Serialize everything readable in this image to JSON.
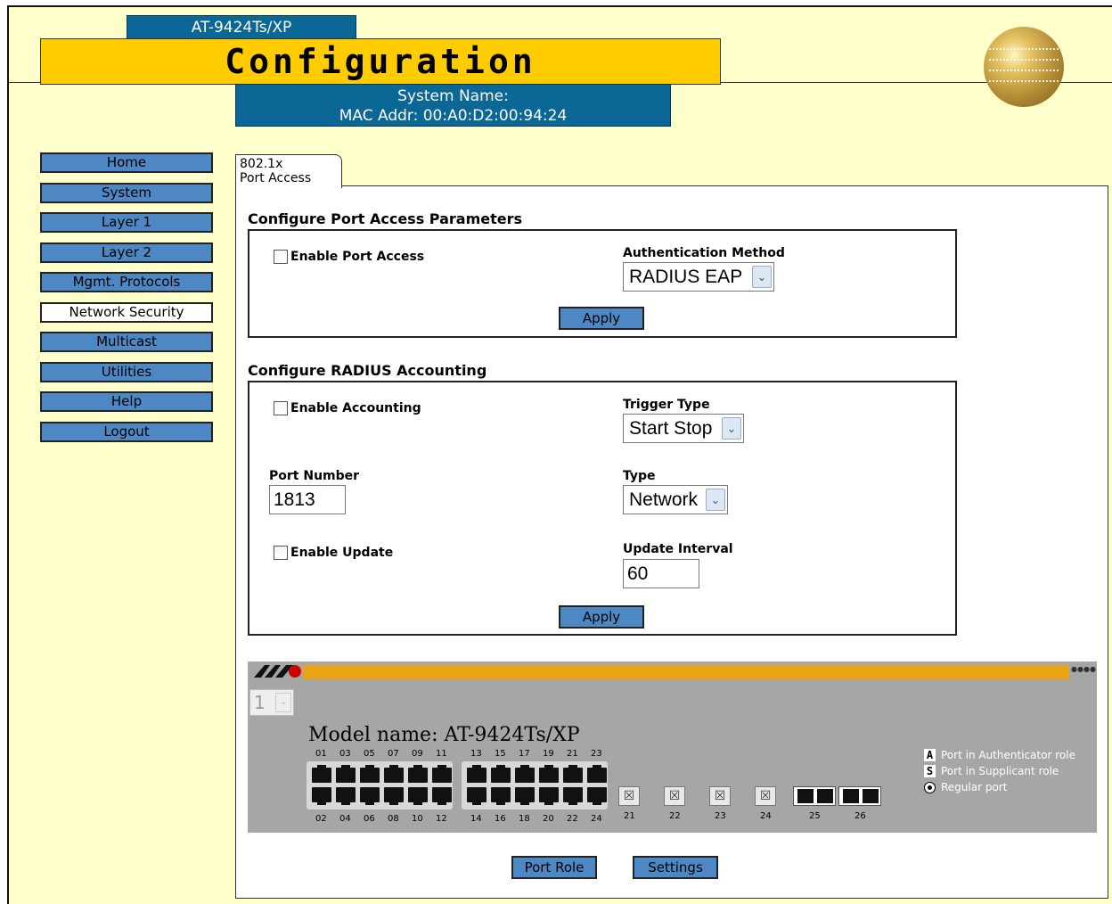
{
  "header": {
    "model_tab": "AT-9424Ts/XP",
    "banner_title": "Configuration",
    "system_name": "System Name:",
    "mac_addr": "MAC Addr: 00:A0:D2:00:94:24"
  },
  "nav": {
    "items": [
      {
        "label": "Home"
      },
      {
        "label": "System"
      },
      {
        "label": "Layer 1"
      },
      {
        "label": "Layer 2"
      },
      {
        "label": "Mgmt. Protocols"
      },
      {
        "label": "Network Security"
      },
      {
        "label": "Multicast"
      },
      {
        "label": "Utilities"
      },
      {
        "label": "Help"
      },
      {
        "label": "Logout"
      }
    ],
    "active": "Network Security"
  },
  "tab": {
    "line1": "802.1x",
    "line2": "Port Access"
  },
  "port_access": {
    "title": "Configure Port Access Parameters",
    "enable_label": "Enable Port Access",
    "enable_checked": false,
    "auth_method_label": "Authentication Method",
    "auth_method_value": "RADIUS EAP",
    "apply_label": "Apply"
  },
  "radius": {
    "title": "Configure RADIUS Accounting",
    "enable_label": "Enable Accounting",
    "enable_checked": false,
    "trigger_type_label": "Trigger Type",
    "trigger_type_value": "Start Stop",
    "port_number_label": "Port Number",
    "port_number_value": "1813",
    "type_label": "Type",
    "type_value": "Network",
    "enable_update_label": "Enable Update",
    "enable_update_checked": false,
    "update_interval_label": "Update Interval",
    "update_interval_value": "60",
    "apply_label": "Apply"
  },
  "switch": {
    "unit_value": "1",
    "model_name": "Model name: AT-9424Ts/XP",
    "top_port_numbers_a": [
      "01",
      "03",
      "05",
      "07",
      "09",
      "11"
    ],
    "top_port_numbers_b": [
      "13",
      "15",
      "17",
      "19",
      "21",
      "23"
    ],
    "bottom_port_numbers_a": [
      "02",
      "04",
      "06",
      "08",
      "10",
      "12"
    ],
    "bottom_port_numbers_b": [
      "14",
      "16",
      "18",
      "20",
      "22",
      "24"
    ],
    "sfp_numbers": [
      "21",
      "22",
      "23",
      "24"
    ],
    "fiber_numbers": [
      "25",
      "26"
    ],
    "legend": [
      {
        "key": "A",
        "text": "Port in Authenticator role"
      },
      {
        "key": "S",
        "text": "Port in Supplicant role"
      },
      {
        "key": "radio",
        "text": "Regular port"
      }
    ],
    "colors": {
      "body": "#a6a6a6",
      "bar": "#e8a319"
    }
  },
  "footer_buttons": {
    "port_role": "Port Role",
    "settings": "Settings"
  }
}
